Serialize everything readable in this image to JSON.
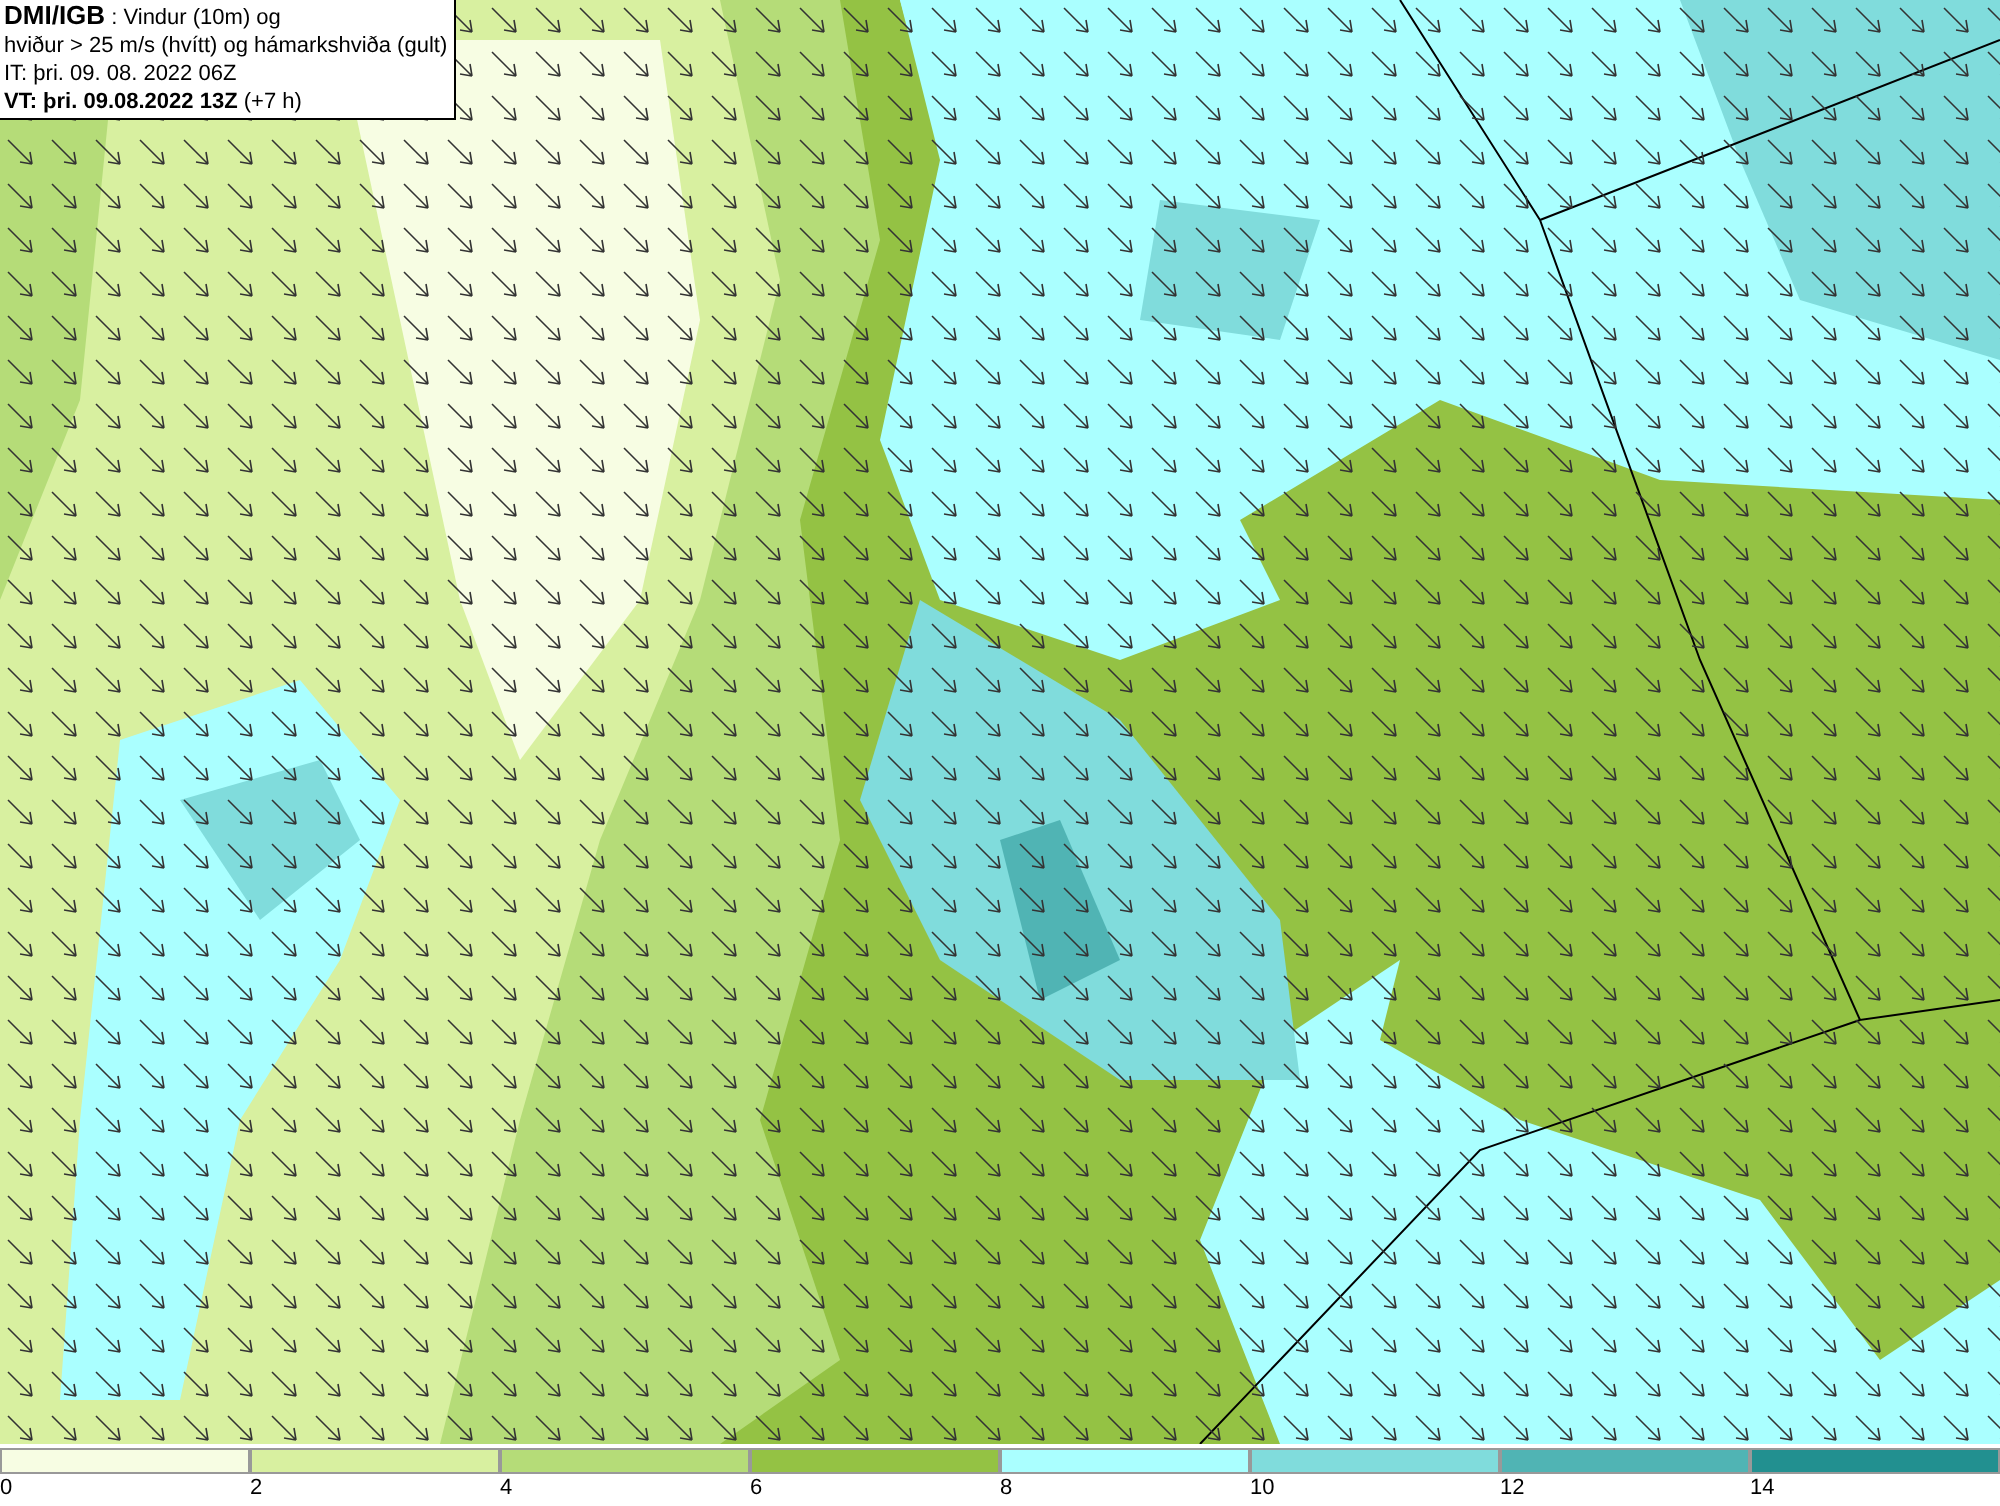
{
  "header": {
    "lines": [
      "**DMI/IGB** : Vindur (10m) og",
      "hviður > 25 m/s (hvítt) og hámarkshviða (gult)",
      "IT: þri. 09. 08. 2022 06Z",
      "**VT: þri. 09.08.2022 13Z** (+7 h)"
    ]
  },
  "legend": {
    "bins": [
      {
        "label": "0",
        "color": "#f7fde3"
      },
      {
        "label": "2",
        "color": "#d8f0a0"
      },
      {
        "label": "4",
        "color": "#b5dc78"
      },
      {
        "label": "6",
        "color": "#94c244"
      },
      {
        "label": "8",
        "color": "#aaffff"
      },
      {
        "label": "10",
        "color": "#80dcdc"
      },
      {
        "label": "12",
        "color": "#50b4b4"
      },
      {
        "label": "14",
        "color": "#229090"
      }
    ]
  }
}
